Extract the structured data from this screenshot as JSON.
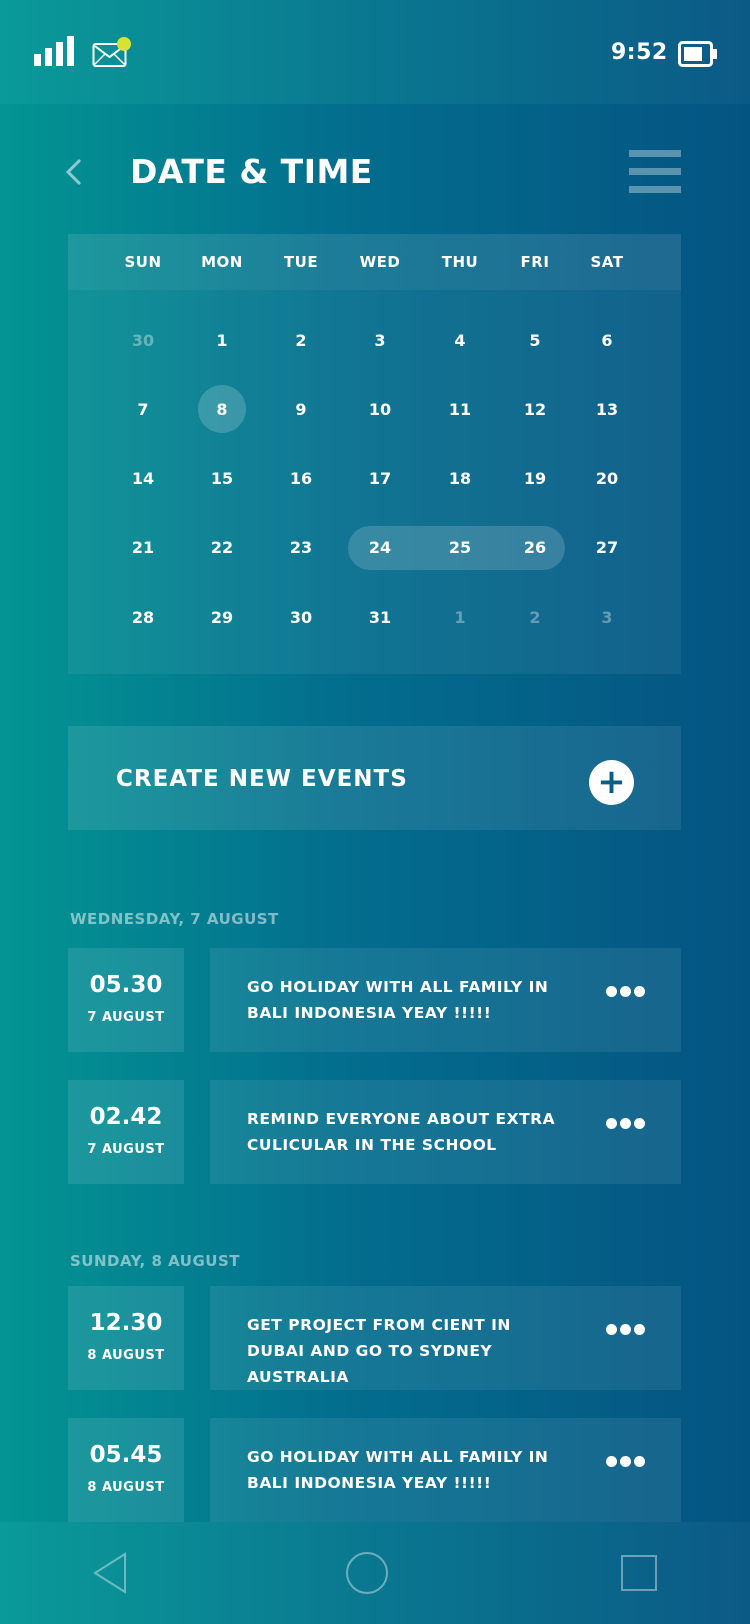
{
  "status_bar": {
    "time": "9:52",
    "icons": [
      "signal-icon",
      "mail-icon",
      "battery-icon"
    ],
    "notification_color": "#d8e233"
  },
  "header": {
    "title": "Date & Time",
    "icons": [
      "chevron-left-icon",
      "menu-icon"
    ]
  },
  "calendar": {
    "weekdays": [
      "SUN",
      "MON",
      "TUE",
      "WED",
      "THU",
      "FRI",
      "SAT"
    ],
    "weeks": [
      [
        "30",
        "1",
        "2",
        "3",
        "4",
        "5",
        "6"
      ],
      [
        "7",
        "8",
        "9",
        "10",
        "11",
        "12",
        "13"
      ],
      [
        "14",
        "15",
        "16",
        "17",
        "18",
        "19",
        "20"
      ],
      [
        "21",
        "22",
        "23",
        "24",
        "25",
        "26",
        "27"
      ],
      [
        "28",
        "29",
        "30",
        "31",
        "1",
        "2",
        "3"
      ]
    ],
    "selected_day": "8",
    "selected_range": [
      "24",
      "25",
      "26"
    ]
  },
  "create": {
    "label": "CREATE NEW EVENTS",
    "icon": "plus-icon"
  },
  "groups": [
    {
      "heading": "WEDNESDAY, 7 AUGUST",
      "events": [
        {
          "time": "05.30",
          "date": "7 AUGUST",
          "text": "GO HOLIDAY WITH ALL FAMILY IN BALI INDONESIA YEAY !!!!!"
        },
        {
          "time": "02.42",
          "date": "7 AUGUST",
          "text": "REMIND EVERYONE ABOUT EXTRA CULICULAR IN THE SCHOOL"
        }
      ]
    },
    {
      "heading": "SUNDAY, 8 AUGUST",
      "events": [
        {
          "time": "12.30",
          "date": "8 AUGUST",
          "text": "GET PROJECT FROM CIENT IN DUBAI AND GO TO SYDNEY AUSTRALIA"
        },
        {
          "time": "05.45",
          "date": "8 AUGUST",
          "text": "GO HOLIDAY WITH ALL FAMILY IN BALI INDONESIA YEAY !!!!!"
        }
      ]
    }
  ],
  "nav_bar": {
    "icons": [
      "nav-back-icon",
      "nav-home-icon",
      "nav-recent-icon"
    ]
  }
}
